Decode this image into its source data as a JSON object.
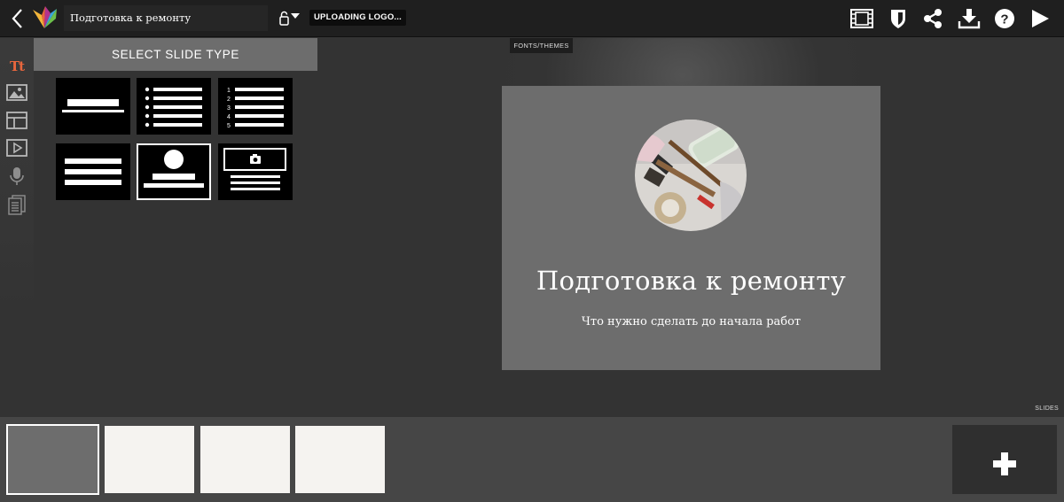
{
  "header": {
    "title": "Подготовка к ремонту",
    "status_badge": "UPLOADING LOGO...",
    "icons": {
      "back": "chevron-left-icon",
      "logo": "adobe-slate-logo",
      "theme": "theme-lock-icon",
      "film": "film-icon",
      "shield": "shield-icon",
      "share": "share-icon",
      "download": "download-icon",
      "help": "help-icon",
      "play": "play-icon"
    }
  },
  "sidebar": {
    "tools": [
      {
        "name": "text-tool",
        "label": "Tt"
      },
      {
        "name": "image-tool",
        "label": ""
      },
      {
        "name": "layout-tool",
        "label": ""
      },
      {
        "name": "video-tool",
        "label": ""
      },
      {
        "name": "audio-tool",
        "label": ""
      },
      {
        "name": "notes-tool",
        "label": ""
      }
    ],
    "active_tool_color": "#e8663d"
  },
  "panel": {
    "title": "SELECT SLIDE TYPE",
    "layouts": [
      {
        "type": "title-only",
        "selected": false
      },
      {
        "type": "bullet-list",
        "selected": false
      },
      {
        "type": "numbered-list",
        "selected": false,
        "numbers": [
          "1",
          "2",
          "3",
          "4",
          "5"
        ]
      },
      {
        "type": "paragraph",
        "selected": false
      },
      {
        "type": "title-with-image",
        "selected": true
      },
      {
        "type": "image-caption",
        "selected": false
      }
    ]
  },
  "canvas": {
    "fonts_tab": "FONTS/THEMES",
    "slide": {
      "title": "Подготовка к ремонту",
      "subtitle": "Что нужно сделать до начала работ",
      "background": "#6d6d6d"
    }
  },
  "filmstrip": {
    "label": "SLIDES",
    "thumbnails": [
      {
        "kind": "title",
        "active": true
      },
      {
        "kind": "blank",
        "active": false
      },
      {
        "kind": "blank",
        "active": false
      },
      {
        "kind": "blank",
        "active": false
      }
    ],
    "add_icon": "plus-icon"
  }
}
